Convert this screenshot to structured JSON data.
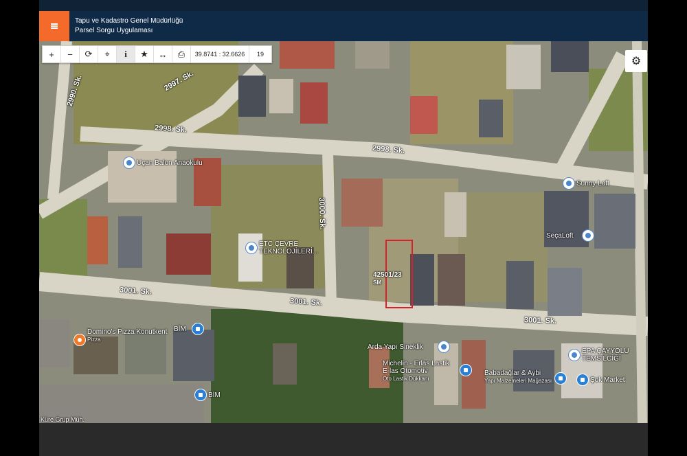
{
  "header": {
    "org": "Tapu ve Kadastro Genel Müdürlüğü",
    "app": "Parsel Sorgu Uygulaması",
    "accent": "#f46a2a",
    "bg": "#0e2a47"
  },
  "toolbar": {
    "zoom_in": "+",
    "zoom_out": "−",
    "refresh": "⟳",
    "locate": "⌖",
    "info": "i",
    "favorite": "★",
    "measure": "↔",
    "print": "⎙",
    "coordinates": "39.8741 : 32.6626",
    "zoom_level": "19"
  },
  "settings": {
    "icon": "⚙"
  },
  "map": {
    "parcel_label": "42501/23",
    "parcel_sub": "SM",
    "streets": [
      "2990. Sk.",
      "2997. Sk.",
      "2998. Sk.",
      "2998. Sk.",
      "3000. Sk.",
      "3001. Sk.",
      "3001. Sk.",
      "3001. Sk."
    ],
    "pois": [
      {
        "name": "Uçan Balon Anaokulu"
      },
      {
        "name": "Sunny Loft"
      },
      {
        "name": "SeçaLoft"
      },
      {
        "name": "ETC ÇEVRE TEKNOLOJİLERİ..."
      },
      {
        "name": "Domino's Pizza Konutkent",
        "sub": "Pizza"
      },
      {
        "name": "BİM"
      },
      {
        "name": "BİM"
      },
      {
        "name": "Arda Yapı Sineklik"
      },
      {
        "name": "Michelin - Erlas Lastik E-las Otomotiv",
        "sub": "Oto Lastik Dükkanı"
      },
      {
        "name": "Babadağlar & Aybi",
        "sub": "Yapı Malzemeleri Mağazası"
      },
      {
        "name": "EPA ÇAYYOLU TEMSİLCİĞİ"
      },
      {
        "name": "Şok Market"
      },
      {
        "name": "Küre Grup Müh."
      }
    ],
    "parcel_color": "#d8202a"
  }
}
